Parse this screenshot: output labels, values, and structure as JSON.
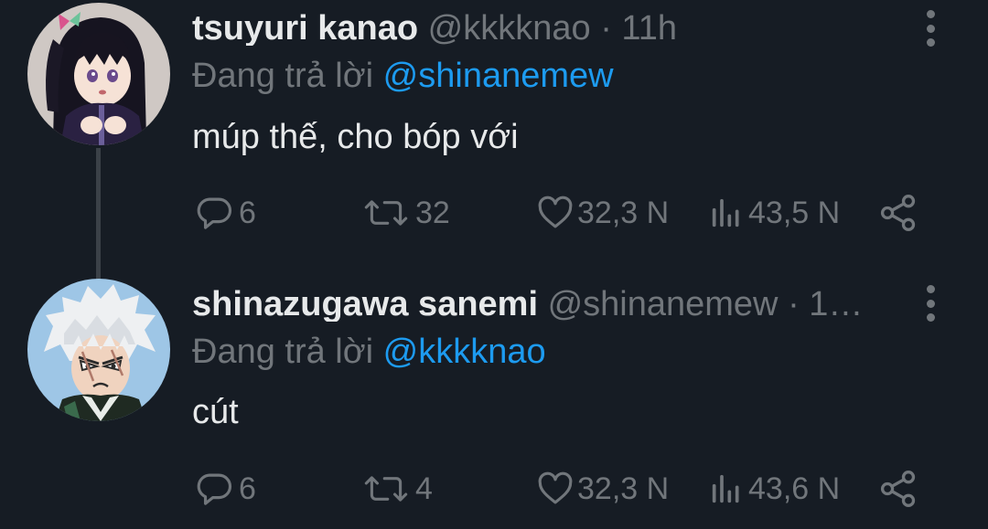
{
  "colors": {
    "background": "#161c24",
    "text_primary": "#e7e9ea",
    "text_secondary": "#71767b",
    "link": "#1d9bf0",
    "thread_line": "#3b4148"
  },
  "tweets": [
    {
      "display_name": "tsuyuri kanao",
      "handle": "@kkkknao",
      "separator": "·",
      "time": "11h",
      "reply_prefix": "Đang trả lời",
      "reply_to": "@shinanemew",
      "text": "múp thế, cho bóp với",
      "stats": {
        "replies": "6",
        "retweets": "32",
        "likes": "32,3 N",
        "views": "43,5 N"
      },
      "icons": [
        "reply-icon",
        "retweet-icon",
        "like-icon",
        "views-icon",
        "share-icon",
        "more-icon"
      ]
    },
    {
      "display_name": "shinazugawa sanemi",
      "handle": "@shinanemew",
      "separator": "·",
      "time": "1…",
      "reply_prefix": "Đang trả lời",
      "reply_to": "@kkkknao",
      "text": "cút",
      "stats": {
        "replies": "6",
        "retweets": "4",
        "likes": "32,3 N",
        "views": "43,6 N"
      },
      "icons": [
        "reply-icon",
        "retweet-icon",
        "like-icon",
        "views-icon",
        "share-icon",
        "more-icon"
      ]
    }
  ]
}
